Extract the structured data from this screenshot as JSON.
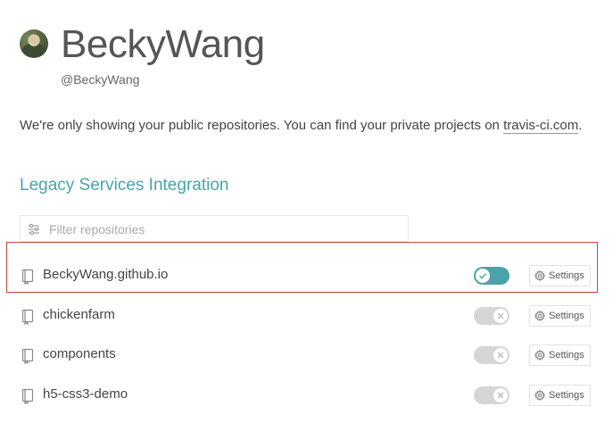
{
  "profile": {
    "name": "BeckyWang",
    "handle": "@BeckyWang",
    "avatar_icon": "user-avatar"
  },
  "notice": {
    "text": "We're only showing your public repositories. You can find your private projects on ",
    "link_text": "travis-ci.com",
    "suffix": "."
  },
  "section": {
    "title": "Legacy Services Integration"
  },
  "filter": {
    "placeholder": "Filter repositories",
    "value": "",
    "icon": "sliders-icon"
  },
  "repositories": [
    {
      "name": "BeckyWang.github.io",
      "enabled": true,
      "settings_label": "Settings",
      "highlighted": true
    },
    {
      "name": "chickenfarm",
      "enabled": false,
      "settings_label": "Settings",
      "highlighted": false
    },
    {
      "name": "components",
      "enabled": false,
      "settings_label": "Settings",
      "highlighted": false
    },
    {
      "name": "h5-css3-demo",
      "enabled": false,
      "settings_label": "Settings",
      "highlighted": false
    }
  ],
  "colors": {
    "accent": "#4aa3a8",
    "highlight_border": "#c9453a",
    "toggle_off": "#d6d6d6"
  }
}
